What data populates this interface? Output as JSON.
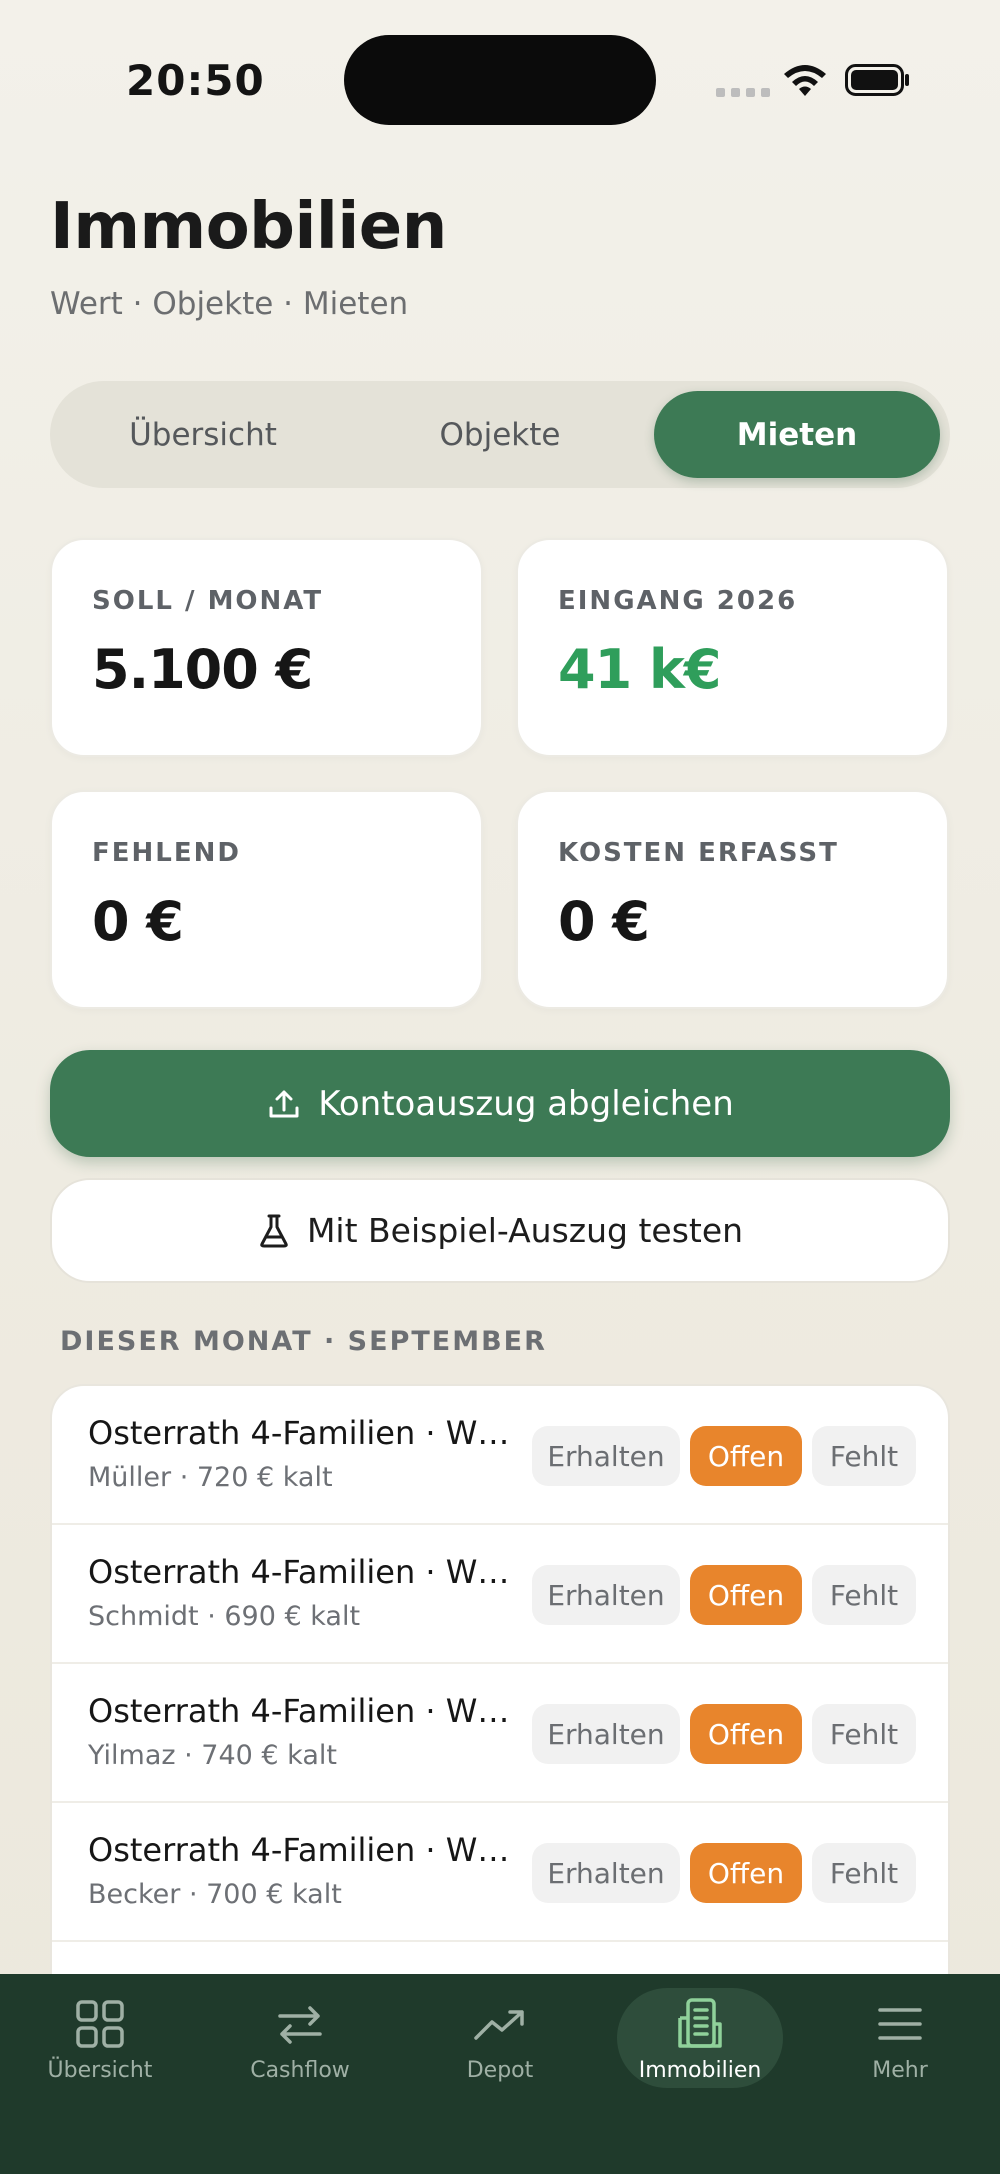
{
  "status": {
    "time": "20:50"
  },
  "header": {
    "title": "Immobilien",
    "subtitle": "Wert · Objekte · Mieten"
  },
  "segments": [
    "Übersicht",
    "Objekte",
    "Mieten"
  ],
  "segments_selected": "Mieten",
  "stats": [
    {
      "label": "SOLL / MONAT",
      "value": "5.100 €"
    },
    {
      "label": "EINGANG 2026",
      "value": "41 k€"
    },
    {
      "label": "FEHLEND",
      "value": "0 €"
    },
    {
      "label": "KOSTEN ERFASST",
      "value": "0 €"
    }
  ],
  "colors": {
    "accent": "#3d7a55",
    "positive": "#2f9e5b",
    "open": "#e8852c",
    "tabbar": "#1f3a2b"
  },
  "actions": {
    "primary": "Kontoauszug abgleichen",
    "primary_icon": "upload-icon",
    "secondary": "Mit Beispiel-Auszug testen",
    "secondary_icon": "flask-icon"
  },
  "section_title": "DIESER MONAT · SEPTEMBER",
  "status_labels": {
    "received": "Erhalten",
    "open": "Offen",
    "missing": "Fehlt"
  },
  "rows": [
    {
      "name": "Osterrath 4-Familien · WH…",
      "meta": "Müller · 720 € kalt",
      "status": "Offen"
    },
    {
      "name": "Osterrath 4-Familien · WH…",
      "meta": "Schmidt · 690 € kalt",
      "status": "Offen"
    },
    {
      "name": "Osterrath 4-Familien · WH…",
      "meta": "Yilmaz · 740 € kalt",
      "status": "Offen"
    },
    {
      "name": "Osterrath 4-Familien · WH…",
      "meta": "Becker · 700 € kalt",
      "status": "Offen"
    }
  ],
  "tabbar": [
    {
      "label": "Übersicht",
      "icon": "grid-icon"
    },
    {
      "label": "Cashflow",
      "icon": "arrows-icon"
    },
    {
      "label": "Depot",
      "icon": "trend-icon"
    },
    {
      "label": "Immobilien",
      "icon": "building-icon",
      "active": true
    },
    {
      "label": "Mehr",
      "icon": "menu-icon"
    }
  ]
}
